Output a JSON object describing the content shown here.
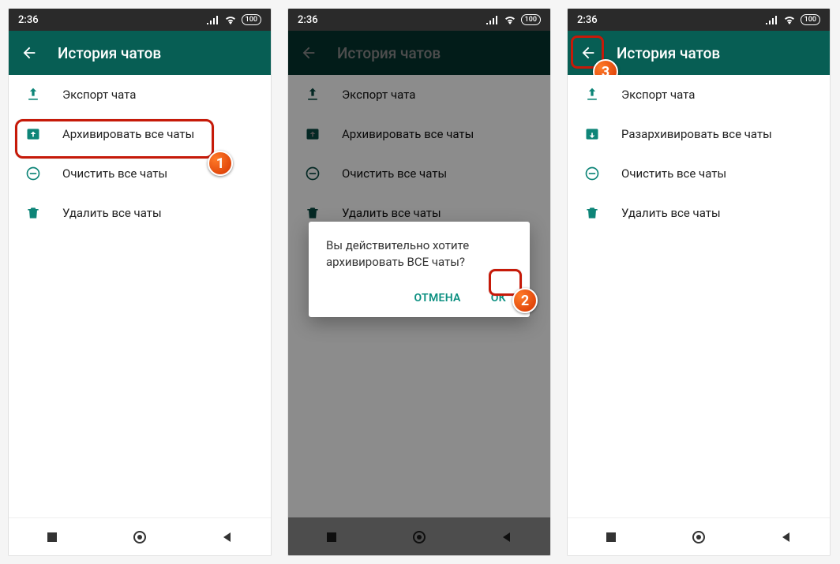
{
  "colors": {
    "primary": "#075e54",
    "accent": "#0e8578",
    "highlight": "#c61a09",
    "badge": "#e24a00"
  },
  "statusbar": {
    "time": "2:36",
    "battery_label": "100"
  },
  "header": {
    "title": "История чатов"
  },
  "menu": {
    "export": {
      "label": "Экспорт чата"
    },
    "archive": {
      "label": "Архивировать все чаты"
    },
    "unarchive": {
      "label": "Разархивировать все чаты"
    },
    "clear": {
      "label": "Очистить все чаты"
    },
    "delete": {
      "label": "Удалить все чаты"
    }
  },
  "dialog": {
    "message": "Вы действительно хотите архивировать ВСЕ чаты?",
    "cancel": "ОТМЕНА",
    "ok": "ОК"
  },
  "steps": {
    "s1": "1",
    "s2": "2",
    "s3": "3"
  }
}
